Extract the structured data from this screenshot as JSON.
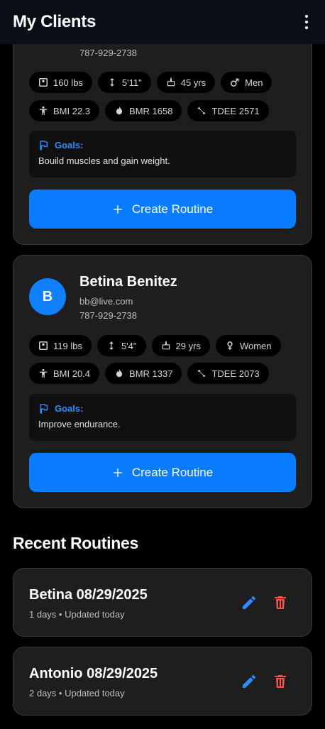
{
  "appbar": {
    "title": "My Clients",
    "menu_icon": "more-vert-icon"
  },
  "clients": [
    {
      "initial": "",
      "name": "",
      "email": "",
      "phone": "787-929-2738",
      "stats": {
        "weight": "160 lbs",
        "height": "5'11\"",
        "age": "45 yrs",
        "gender": "Men",
        "bmi": "BMI 22.3",
        "bmr": "BMR 1658",
        "tdee": "TDEE 2571"
      },
      "goals_label": "Goals:",
      "goals_text": "Bouild muscles and gain weight.",
      "create_label": "Create Routine"
    },
    {
      "initial": "B",
      "name": "Betina Benitez",
      "email": "bb@live.com",
      "phone": "787-929-2738",
      "stats": {
        "weight": "119 lbs",
        "height": "5'4\"",
        "age": "29 yrs",
        "gender": "Women",
        "bmi": "BMI 20.4",
        "bmr": "BMR 1337",
        "tdee": "TDEE 2073"
      },
      "goals_label": "Goals:",
      "goals_text": "Improve endurance.",
      "create_label": "Create Routine"
    }
  ],
  "recent": {
    "title": "Recent Routines",
    "items": [
      {
        "title": "Betina 08/29/2025",
        "meta": "1 days • Updated today"
      },
      {
        "title": "Antonio 08/29/2025",
        "meta": "2 days • Updated today"
      }
    ]
  },
  "colors": {
    "accent": "#0a7cff",
    "goals": "#2f8cff",
    "delete": "#ff4d4d",
    "background": "#000000",
    "card": "#1e1e1e"
  }
}
